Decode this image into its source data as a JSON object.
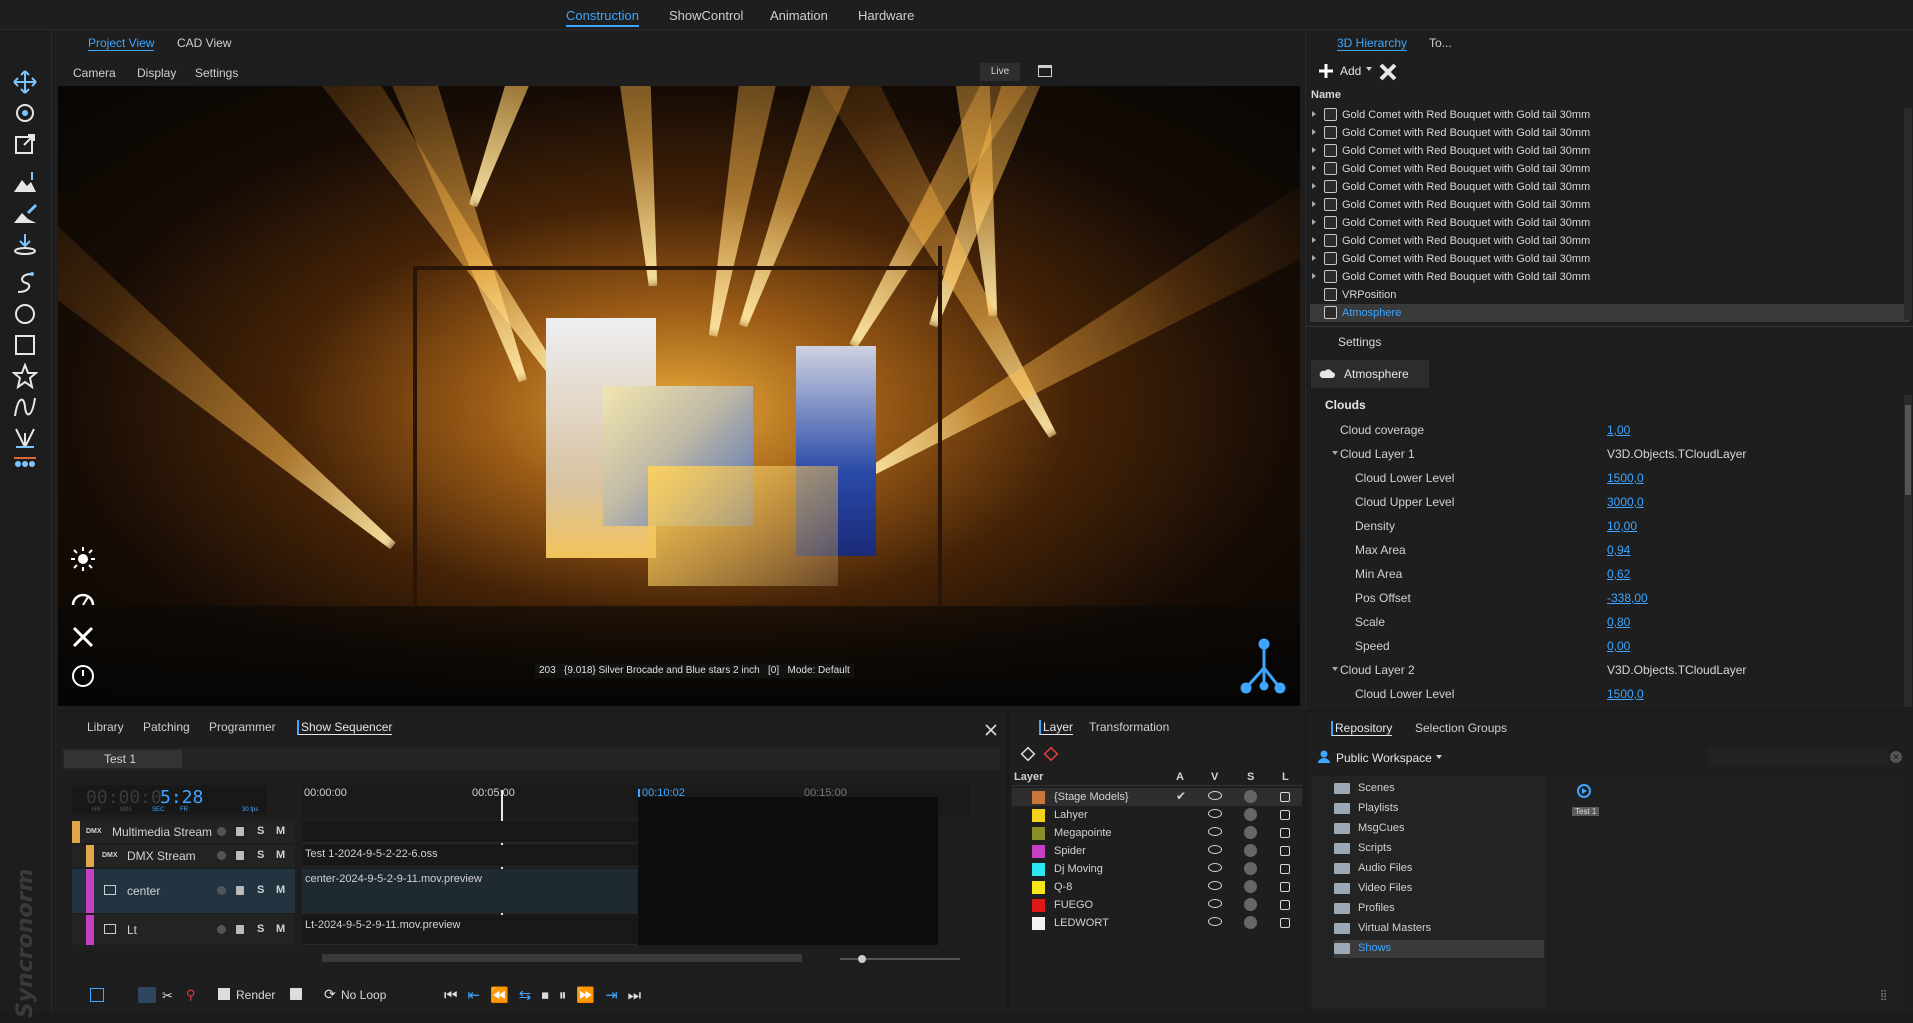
{
  "top_tabs": [
    "Construction",
    "ShowControl",
    "Animation",
    "Hardware"
  ],
  "viewport": {
    "tabs": [
      "Project View",
      "CAD View"
    ],
    "menu": [
      "Camera",
      "Display",
      "Settings"
    ],
    "live_label": "Live",
    "status_text": "203   {9.018} Silver Brocade and Blue stars 2 inch   [0]   Mode: Default"
  },
  "hierarchy": {
    "tabs": [
      "3D Hierarchy",
      "To..."
    ],
    "add_label": "Add",
    "column_name": "Name",
    "items": [
      "Gold Comet with Red Bouquet with Gold tail 30mm",
      "Gold Comet with Red Bouquet with Gold tail 30mm",
      "Gold Comet with Red Bouquet with Gold tail 30mm",
      "Gold Comet with Red Bouquet with Gold tail 30mm",
      "Gold Comet with Red Bouquet with Gold tail 30mm",
      "Gold Comet with Red Bouquet with Gold tail 30mm",
      "Gold Comet with Red Bouquet with Gold tail 30mm",
      "Gold Comet with Red Bouquet with Gold tail 30mm",
      "Gold Comet with Red Bouquet with Gold tail 30mm",
      "Gold Comet with Red Bouquet with Gold tail 30mm",
      "VRPosition",
      "Atmosphere"
    ],
    "selected": "Atmosphere"
  },
  "settings": {
    "title": "Settings",
    "object_tab": "Atmosphere",
    "section": "Clouds",
    "rows": [
      {
        "name": "Cloud coverage",
        "value": "1,00",
        "indent": 0
      },
      {
        "name": "Cloud Layer 1",
        "value": "V3D.Objects.TCloudLayer",
        "indent": 0
      },
      {
        "name": "Cloud Lower Level",
        "value": "1500,0",
        "indent": 1
      },
      {
        "name": "Cloud Upper Level",
        "value": "3000,0",
        "indent": 1
      },
      {
        "name": "Density",
        "value": "10,00",
        "indent": 1
      },
      {
        "name": "Max Area",
        "value": "0,94",
        "indent": 1
      },
      {
        "name": "Min Area",
        "value": "0,62",
        "indent": 1
      },
      {
        "name": "Pos Offset",
        "value": "-338,00",
        "indent": 1
      },
      {
        "name": "Scale",
        "value": "0,80",
        "indent": 1
      },
      {
        "name": "Speed",
        "value": "0,00",
        "indent": 1
      },
      {
        "name": "Cloud Layer 2",
        "value": "V3D.Objects.TCloudLayer",
        "indent": 0
      },
      {
        "name": "Cloud Lower Level",
        "value": "1500,0",
        "indent": 1
      }
    ]
  },
  "sequencer": {
    "tabs": [
      "Library",
      "Patching",
      "Programmer",
      "Show Sequencer"
    ],
    "show_tab": "Test 1",
    "timecode_dim": "00:00:0",
    "timecode": "5:28",
    "timecode_units": [
      "HR",
      "MIN",
      "SEC",
      "FR"
    ],
    "fps": "30 fps",
    "ruler": [
      "00:00:00",
      "00:05:00",
      "00:10:02",
      "00:15:00"
    ],
    "tracks": [
      {
        "name": "Multimedia Stream",
        "tag": "DMX",
        "clip": ""
      },
      {
        "name": "DMX Stream",
        "tag": "DMX",
        "clip": "Test 1-2024-9-5-2-22-6.oss"
      },
      {
        "name": "center",
        "tag": "",
        "clip": "center-2024-9-5-2-9-11.mov.preview"
      },
      {
        "name": "Lt",
        "tag": "",
        "clip": "Lt-2024-9-5-2-9-11.mov.preview"
      }
    ],
    "track_flags": [
      "S",
      "M"
    ],
    "bottom": {
      "render": "Render",
      "loop": "No Loop"
    }
  },
  "layers": {
    "tabs": [
      "Layer",
      "Transformation"
    ],
    "columns": [
      "Layer",
      "A",
      "V",
      "S",
      "L"
    ],
    "items": [
      {
        "name": "{Stage Models}",
        "color": "#c8763a"
      },
      {
        "name": "Lahyer",
        "color": "#f2d21b"
      },
      {
        "name": "Megapointe",
        "color": "#8a8f2a"
      },
      {
        "name": "Spider",
        "color": "#c43fc4"
      },
      {
        "name": "Dj Moving",
        "color": "#2ee6f0"
      },
      {
        "name": "Q-8",
        "color": "#f5e51a"
      },
      {
        "name": "FUEGO",
        "color": "#e01818"
      },
      {
        "name": "LEDWORT",
        "color": "#f2f2f2"
      }
    ]
  },
  "repository": {
    "tabs": [
      "Repository",
      "Selection Groups"
    ],
    "workspace": "Public Workspace",
    "folders": [
      "Scenes",
      "Playlists",
      "MsgCues",
      "Scripts",
      "Audio Files",
      "Video Files",
      "Profiles",
      "Virtual Masters",
      "Shows"
    ],
    "selected": "Shows",
    "preview_label": "Test 1"
  },
  "colors": {
    "accent": "#3ea6ff",
    "background": "#1b1b1b",
    "panel": "#1e1e1e"
  }
}
